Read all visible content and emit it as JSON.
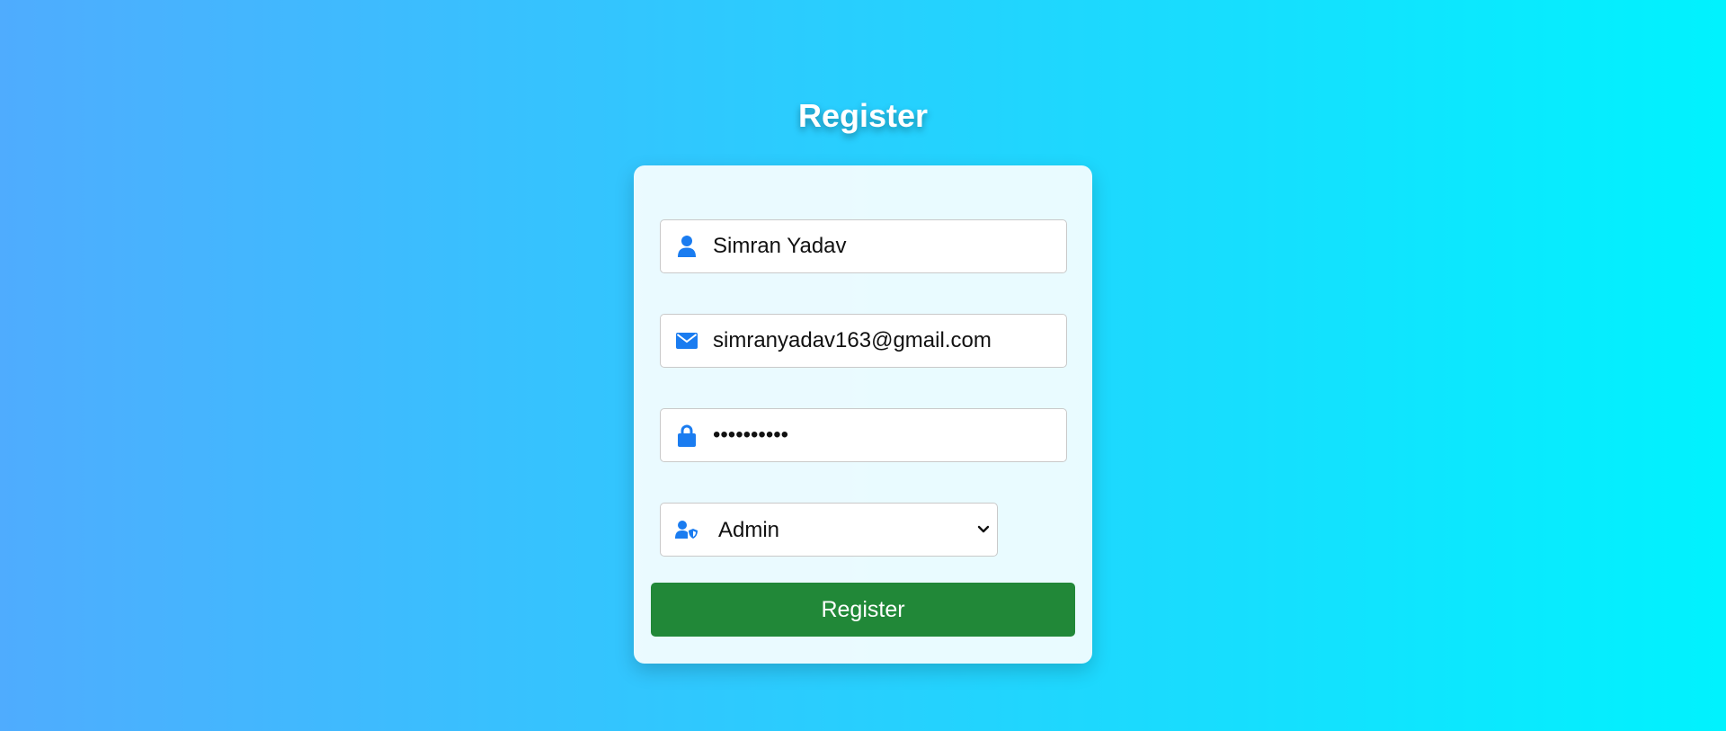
{
  "page": {
    "title": "Register"
  },
  "form": {
    "name": {
      "icon": "user-icon",
      "value": "Simran Yadav"
    },
    "email": {
      "icon": "envelope-icon",
      "value": "simranyadav163@gmail.com"
    },
    "password": {
      "icon": "lock-icon",
      "value": "1234567890"
    },
    "role": {
      "icon": "user-shield-icon",
      "selected": "Admin",
      "options": [
        "Admin"
      ]
    },
    "submit_label": "Register"
  },
  "colors": {
    "background_start": "#4facfe",
    "background_end": "#00f2fe",
    "icon": "#1a7cf0",
    "button": "#218838",
    "button_text": "#ffffff"
  }
}
